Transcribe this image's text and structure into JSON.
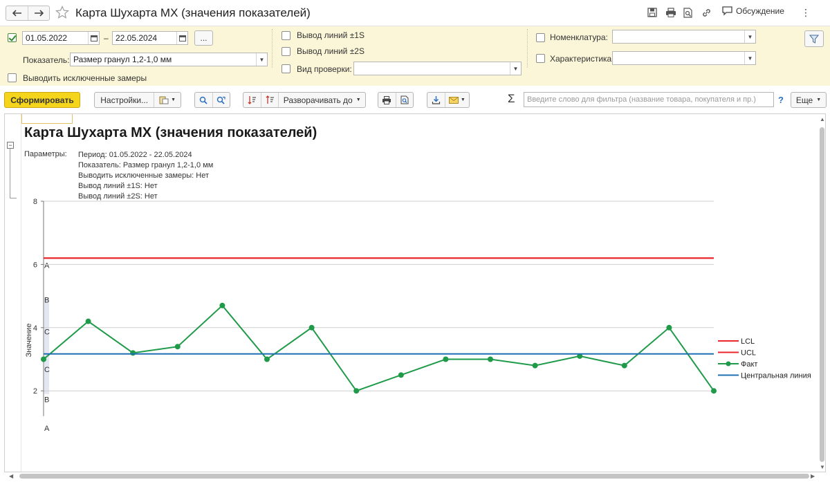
{
  "window": {
    "title": "Карта Шухарта MX (значения показателей)",
    "discuss_label": "Обсуждение"
  },
  "filters": {
    "period_enabled": true,
    "date_from": "01.05.2022",
    "date_sep": "–",
    "date_to": "22.05.2024",
    "ellipsis_label": "...",
    "indicator_label": "Показатель:",
    "indicator_value": "Размер гранул 1,2-1,0 мм",
    "show_excluded_label": "Выводить исключенные замеры",
    "show_excluded": false,
    "line_1s_label": "Вывод линий ±1S",
    "line_1s": false,
    "line_2s_label": "Вывод линий ±2S",
    "line_2s": false,
    "check_type_label": "Вид проверки:",
    "check_type_value": "",
    "check_type_enabled": false,
    "nomenclature_label": "Номенклатура:",
    "nomenclature_value": "",
    "nomenclature_enabled": false,
    "characteristic_label": "Характеристика:",
    "characteristic_value": "",
    "characteristic_enabled": false
  },
  "toolbar": {
    "generate_label": "Сформировать",
    "settings_label": "Настройки...",
    "expand_label": "Разворачивать до",
    "filter_placeholder": "Введите слово для фильтра (название товара, покупателя и пр.)",
    "help_label": "?",
    "more_label": "Еще"
  },
  "report": {
    "title": "Карта Шухарта MX (значения показателей)",
    "params_label": "Параметры:",
    "params": [
      "Период: 01.05.2022 - 22.05.2024",
      "Показатель: Размер гранул 1,2-1,0 мм",
      "Выводить исключенные замеры: Нет",
      "Вывод линий ±1S: Нет",
      "Вывод линий ±2S: Нет"
    ]
  },
  "chart_data": {
    "type": "line",
    "ylabel": "Значение",
    "xlabel": "",
    "ylim": [
      1.2,
      8
    ],
    "yticks": [
      2,
      4,
      6,
      8
    ],
    "grid": true,
    "legend_position": "right",
    "zones": [
      "A",
      "B",
      "C",
      "C",
      "B",
      "A"
    ],
    "series": [
      {
        "name": "LCL",
        "color": "#e8262b",
        "values": [
          6.2,
          6.2,
          6.2,
          6.2,
          6.2,
          6.2,
          6.2,
          6.2,
          6.2,
          6.2,
          6.2,
          6.2,
          6.2,
          6.2,
          6.2,
          6.2
        ]
      },
      {
        "name": "UCL",
        "color": "#e8262b",
        "values": [
          6.2,
          6.2,
          6.2,
          6.2,
          6.2,
          6.2,
          6.2,
          6.2,
          6.2,
          6.2,
          6.2,
          6.2,
          6.2,
          6.2,
          6.2,
          6.2
        ]
      },
      {
        "name": "Факт",
        "color": "#1e9a48",
        "markers": true,
        "values": [
          3.0,
          4.2,
          3.2,
          3.4,
          4.7,
          3.0,
          4.0,
          2.0,
          2.5,
          3.0,
          3.0,
          2.8,
          3.1,
          2.8,
          4.0,
          2.0
        ]
      },
      {
        "name": "Центральная линия",
        "color": "#1f6fb3",
        "values": [
          3.17,
          3.17,
          3.17,
          3.17,
          3.17,
          3.17,
          3.17,
          3.17,
          3.17,
          3.17,
          3.17,
          3.17,
          3.17,
          3.17,
          3.17,
          3.17
        ]
      }
    ]
  },
  "colors": {
    "filter_bg": "#fbf6d8",
    "primary_button": "#f5d51c",
    "accent_blue": "#2d6fc0"
  }
}
